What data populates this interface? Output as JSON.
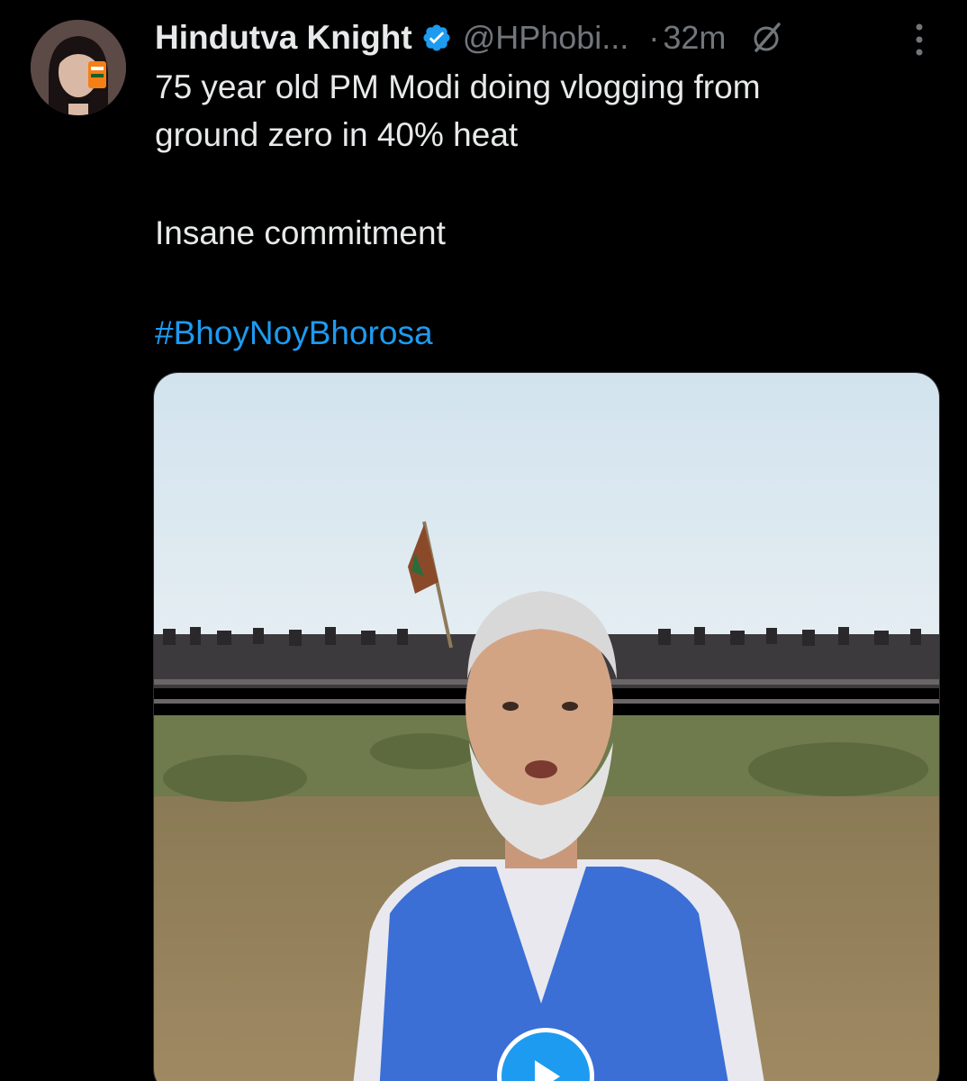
{
  "author": {
    "display_name": "Hindutva Knight",
    "handle": "@HPhobi...",
    "verified": true,
    "avatar_icon": "profile-photo"
  },
  "meta": {
    "separator": "·",
    "time": "32m",
    "grok_icon": "grok-slash-circle-icon",
    "more_icon": "vertical-ellipsis-icon"
  },
  "body": {
    "line1": "75 year old PM Modi doing vlogging from",
    "line2": "ground zero in 40% heat",
    "line3": "Insane commitment",
    "hashtag": "#BhoyNoyBhorosa"
  },
  "media": {
    "type": "video",
    "play_icon": "play-icon"
  },
  "colors": {
    "background": "#000000",
    "primary_text": "#e7e9ea",
    "secondary_text": "#71767b",
    "link": "#1d9bf0",
    "verified_badge": "#1d9bf0"
  }
}
